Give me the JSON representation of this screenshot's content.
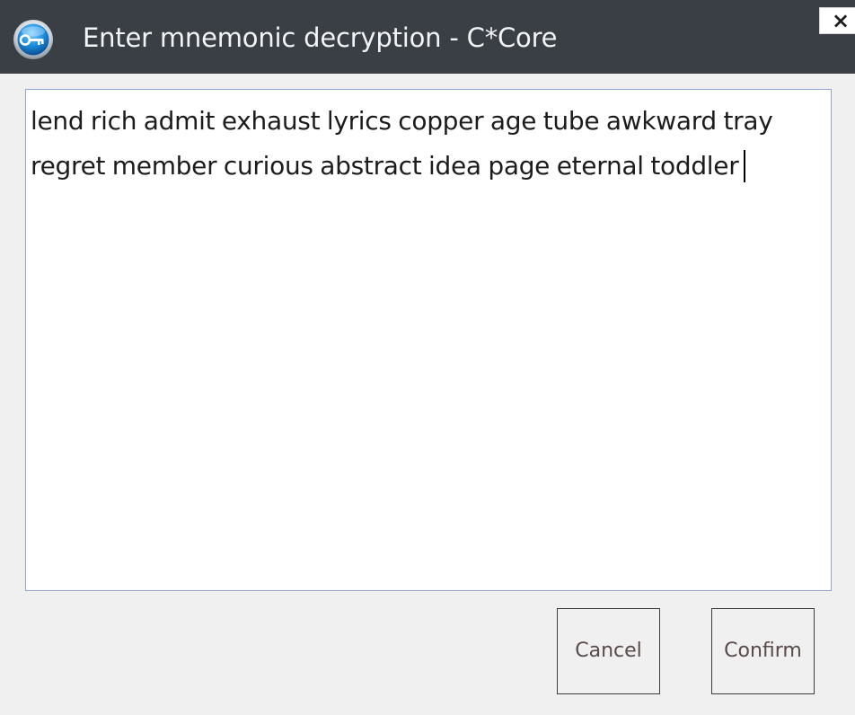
{
  "window": {
    "title": "Enter mnemonic decryption - C*Core",
    "app_icon": "key-icon",
    "close_label": "×",
    "close_icon": "close-icon"
  },
  "mnemonic": {
    "value": "lend rich admit exhaust lyrics copper age tube awkward tray regret member curious abstract idea page eternal toddler"
  },
  "buttons": {
    "cancel_label": "Cancel",
    "confirm_label": "Confirm"
  },
  "colors": {
    "titlebar": "#3a3f46",
    "title_text": "#f2f4f6",
    "window_bg": "#f0f0f0",
    "input_border": "#8fa8cc",
    "button_text": "#5a4a4a"
  }
}
